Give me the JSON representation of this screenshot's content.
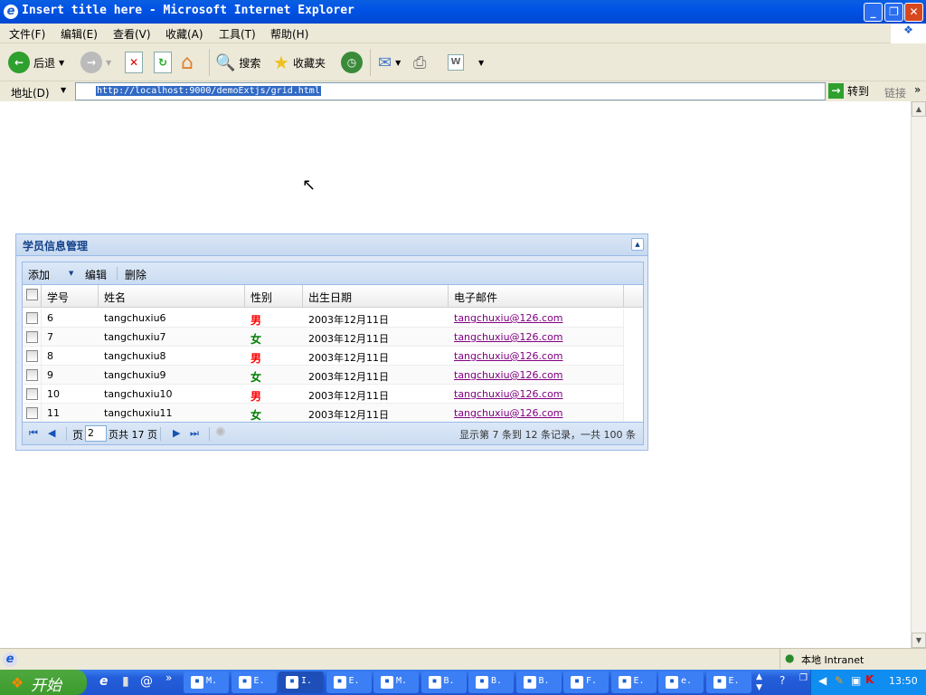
{
  "window": {
    "title": "Insert title here - Microsoft Internet Explorer"
  },
  "menu": [
    "文件(F)",
    "编辑(E)",
    "查看(V)",
    "收藏(A)",
    "工具(T)",
    "帮助(H)"
  ],
  "toolbar": {
    "back": "后退",
    "search": "搜索",
    "favorites": "收藏夹"
  },
  "address": {
    "label": "地址(D)",
    "url": "http://localhost:9000/demoExtjs/grid.html",
    "go": "转到",
    "links": "链接"
  },
  "panel": {
    "title": "学员信息管理",
    "toolbar": [
      "添加",
      "编辑",
      "删除"
    ],
    "columns": [
      "学号",
      "姓名",
      "性别",
      "出生日期",
      "电子邮件"
    ],
    "rows": [
      {
        "id": "6",
        "name": "tangchuxiu6",
        "gender": "男",
        "birth": "2003年12月11日",
        "email": "tangchuxiu@126.com"
      },
      {
        "id": "7",
        "name": "tangchuxiu7",
        "gender": "女",
        "birth": "2003年12月11日",
        "email": "tangchuxiu@126.com"
      },
      {
        "id": "8",
        "name": "tangchuxiu8",
        "gender": "男",
        "birth": "2003年12月11日",
        "email": "tangchuxiu@126.com"
      },
      {
        "id": "9",
        "name": "tangchuxiu9",
        "gender": "女",
        "birth": "2003年12月11日",
        "email": "tangchuxiu@126.com"
      },
      {
        "id": "10",
        "name": "tangchuxiu10",
        "gender": "男",
        "birth": "2003年12月11日",
        "email": "tangchuxiu@126.com"
      },
      {
        "id": "11",
        "name": "tangchuxiu11",
        "gender": "女",
        "birth": "2003年12月11日",
        "email": "tangchuxiu@126.com"
      }
    ],
    "paging": {
      "page_label": "页",
      "page": "2",
      "of_label": "页共 17 页",
      "summary": "显示第 7 条到 12 条记录，一共 100 条"
    }
  },
  "status": {
    "zone": "本地 Intranet"
  },
  "taskbar": {
    "start": "开始",
    "tasks": [
      "M.",
      "E.",
      "I.",
      "E.",
      "M.",
      "B.",
      "B.",
      "B.",
      "F.",
      "E.",
      "e.",
      "E."
    ],
    "clock": "13:50"
  }
}
